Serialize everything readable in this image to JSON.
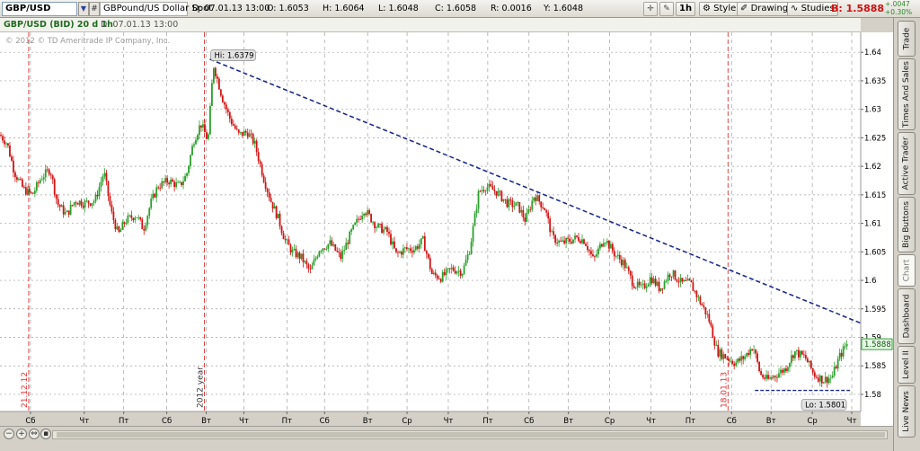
{
  "toolbar": {
    "symbol": "GBP/USD",
    "description": "GBPound/US Dollar Spot",
    "date": "D: 07.01.13 13:00",
    "open": "O: 1.6053",
    "high": "H: 1.6064",
    "low": "L: 1.6048",
    "close": "C: 1.6058",
    "range": "R: 0.0016",
    "y": "Y: 1.6048",
    "timeframe": "1h",
    "style_label": "Style",
    "drawings_label": "Drawings",
    "studies_label": "Studies",
    "bid_price": "B: 1.5888",
    "change_abs": "+.0047",
    "change_pct": "+0.30%"
  },
  "title": {
    "main": "GBP/USD (BID) 20 d 1h",
    "copyright": "© 2012 © TD Ameritrade IP Company, Inc."
  },
  "side_tabs": [
    "Trade",
    "Times And Sales",
    "Active Trader",
    "Big Buttons",
    "Chart",
    "Dashboard",
    "Level II",
    "Live News"
  ],
  "colors": {
    "up": "#2aa02a",
    "down": "#d01414",
    "trendline": "#1c2c8c",
    "separator": "#e03030",
    "grid": "#a0a0a0"
  },
  "chart_data": {
    "type": "candlestick",
    "ylim": [
      1.577,
      1.6435
    ],
    "yticks": [
      1.58,
      1.585,
      1.59,
      1.595,
      1.6,
      1.605,
      1.61,
      1.615,
      1.62,
      1.625,
      1.63,
      1.635,
      1.64
    ],
    "ytick_labels": [
      "1.58",
      "1.585",
      "1.59",
      "1.595",
      "1.6",
      "1.605",
      "1.61",
      "1.615",
      "1.62",
      "1.625",
      "1.63",
      "1.635",
      "1.64"
    ],
    "x_range": [
      0,
      480
    ],
    "x_ticks": [
      {
        "x": 17,
        "label": "Сб"
      },
      {
        "x": 47,
        "label": "Чт"
      },
      {
        "x": 69,
        "label": "Пт"
      },
      {
        "x": 93,
        "label": "Сб"
      },
      {
        "x": 115,
        "label": "Вт"
      },
      {
        "x": 136,
        "label": "Чт"
      },
      {
        "x": 160,
        "label": "Пт"
      },
      {
        "x": 181,
        "label": "Сб"
      },
      {
        "x": 205,
        "label": "Вт"
      },
      {
        "x": 227,
        "label": "Ср"
      },
      {
        "x": 250,
        "label": "Чт"
      },
      {
        "x": 272,
        "label": "Пт"
      },
      {
        "x": 295,
        "label": "Сб"
      },
      {
        "x": 317,
        "label": "Вт"
      },
      {
        "x": 340,
        "label": "Ср"
      },
      {
        "x": 363,
        "label": "Чт"
      },
      {
        "x": 385,
        "label": "Пт"
      },
      {
        "x": 408,
        "label": "Сб"
      },
      {
        "x": 430,
        "label": "Вт"
      },
      {
        "x": 453,
        "label": "Ср"
      },
      {
        "x": 475,
        "label": "Чт"
      }
    ],
    "separators": [
      {
        "x": 16,
        "label": "21.12.12"
      },
      {
        "x": 114,
        "label": "2012 year"
      },
      {
        "x": 406,
        "label": "18.01.13"
      }
    ],
    "path": [
      [
        0,
        1.6255
      ],
      [
        4,
        1.624
      ],
      [
        8,
        1.619
      ],
      [
        13,
        1.616
      ],
      [
        18,
        1.615
      ],
      [
        23,
        1.618
      ],
      [
        28,
        1.6195
      ],
      [
        32,
        1.6135
      ],
      [
        37,
        1.6115
      ],
      [
        42,
        1.614
      ],
      [
        47,
        1.6135
      ],
      [
        53,
        1.614
      ],
      [
        58,
        1.619
      ],
      [
        62,
        1.612
      ],
      [
        66,
        1.608
      ],
      [
        70,
        1.6105
      ],
      [
        76,
        1.6115
      ],
      [
        80,
        1.609
      ],
      [
        84,
        1.6135
      ],
      [
        88,
        1.6165
      ],
      [
        94,
        1.6175
      ],
      [
        100,
        1.6165
      ],
      [
        104,
        1.6185
      ],
      [
        108,
        1.6245
      ],
      [
        112,
        1.6275
      ],
      [
        116,
        1.6245
      ],
      [
        119,
        1.6379
      ],
      [
        124,
        1.632
      ],
      [
        128,
        1.6285
      ],
      [
        133,
        1.6255
      ],
      [
        138,
        1.626
      ],
      [
        142,
        1.624
      ],
      [
        147,
        1.618
      ],
      [
        151,
        1.614
      ],
      [
        155,
        1.611
      ],
      [
        159,
        1.607
      ],
      [
        163,
        1.605
      ],
      [
        168,
        1.604
      ],
      [
        173,
        1.6015
      ],
      [
        178,
        1.6055
      ],
      [
        184,
        1.6065
      ],
      [
        190,
        1.604
      ],
      [
        196,
        1.6085
      ],
      [
        203,
        1.6125
      ],
      [
        210,
        1.6095
      ],
      [
        216,
        1.6085
      ],
      [
        221,
        1.6045
      ],
      [
        226,
        1.6055
      ],
      [
        231,
        1.6055
      ],
      [
        236,
        1.607
      ],
      [
        241,
        1.601
      ],
      [
        246,
        1.6005
      ],
      [
        252,
        1.602
      ],
      [
        258,
        1.6015
      ],
      [
        262,
        1.6055
      ],
      [
        267,
        1.6155
      ],
      [
        271,
        1.6165
      ],
      [
        277,
        1.6155
      ],
      [
        283,
        1.6135
      ],
      [
        289,
        1.613
      ],
      [
        293,
        1.6105
      ],
      [
        298,
        1.615
      ],
      [
        304,
        1.6125
      ],
      [
        308,
        1.6075
      ],
      [
        313,
        1.6065
      ],
      [
        318,
        1.607
      ],
      [
        322,
        1.6075
      ],
      [
        326,
        1.607
      ],
      [
        331,
        1.6035
      ],
      [
        337,
        1.6075
      ],
      [
        343,
        1.6045
      ],
      [
        348,
        1.603
      ],
      [
        353,
        1.5995
      ],
      [
        358,
        1.5985
      ],
      [
        363,
        1.6005
      ],
      [
        368,
        1.5985
      ],
      [
        374,
        1.6015
      ],
      [
        380,
        1.5995
      ],
      [
        385,
        1.5995
      ],
      [
        390,
        1.5965
      ],
      [
        395,
        1.5935
      ],
      [
        400,
        1.5875
      ],
      [
        405,
        1.5865
      ],
      [
        410,
        1.5855
      ],
      [
        415,
        1.5865
      ],
      [
        420,
        1.5885
      ],
      [
        424,
        1.5835
      ],
      [
        428,
        1.5825
      ],
      [
        433,
        1.5835
      ],
      [
        438,
        1.5845
      ],
      [
        443,
        1.5875
      ],
      [
        449,
        1.5865
      ],
      [
        454,
        1.5835
      ],
      [
        459,
        1.5825
      ],
      [
        464,
        1.583
      ],
      [
        468,
        1.5865
      ],
      [
        472,
        1.5888
      ]
    ],
    "annotations": [
      {
        "type": "high",
        "x": 119,
        "y": 1.6379,
        "label": "Hi: 1.6379"
      },
      {
        "type": "low",
        "x": 458,
        "y": 1.5801,
        "label": "Lo: 1.5801"
      }
    ],
    "trendline": {
      "from": [
        117,
        1.6388
      ],
      "to": [
        480,
        1.5925
      ]
    },
    "support_line": {
      "from": [
        421,
        1.5807
      ],
      "to": [
        474,
        1.5807
      ]
    },
    "last_price": {
      "value": 1.5888,
      "label": "1.5888"
    }
  }
}
